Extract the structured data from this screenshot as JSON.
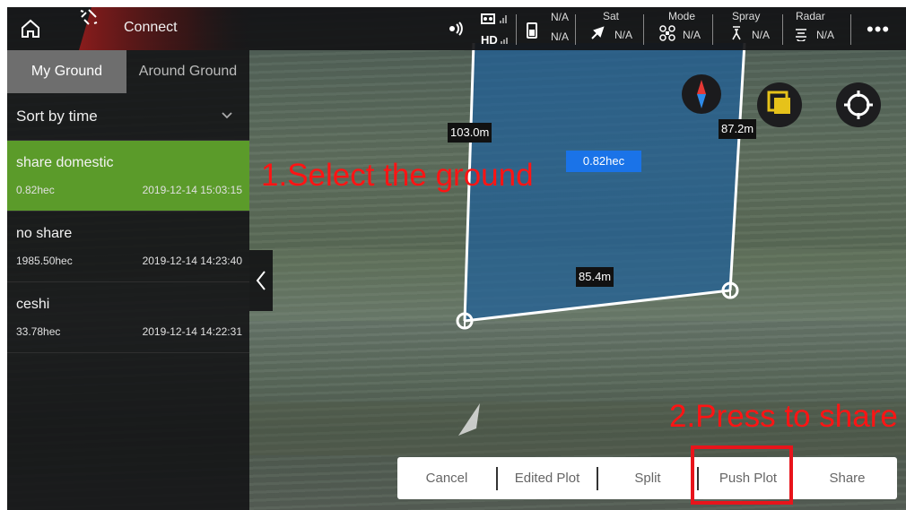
{
  "topbar": {
    "connect_label": "Connect",
    "signal_hd": "HD",
    "battery_value": "N/A",
    "battery_value2": "N/A",
    "stats": [
      {
        "label": "Sat",
        "value": "N/A",
        "icon": "satellite-icon"
      },
      {
        "label": "Mode",
        "value": "N/A",
        "icon": "drone-icon"
      },
      {
        "label": "Spray",
        "value": "N/A",
        "icon": "spray-icon"
      },
      {
        "label": "Radar",
        "value": "N/A",
        "icon": "radar-icon"
      }
    ],
    "more": "•••"
  },
  "sidebar": {
    "tabs": [
      "My Ground",
      "Around Ground"
    ],
    "sort_label": "Sort by time",
    "items": [
      {
        "name": "share domestic",
        "area": "0.82hec",
        "time": "2019-12-14 15:03:15",
        "selected": true
      },
      {
        "name": "no share",
        "area": "1985.50hec",
        "time": "2019-12-14 14:23:40",
        "selected": false
      },
      {
        "name": "ceshi",
        "area": "33.78hec",
        "time": "2019-12-14 14:22:31",
        "selected": false
      }
    ]
  },
  "map": {
    "edge_left": "103.0m",
    "edge_right": "87.2m",
    "edge_bottom": "85.4m",
    "area": "0.82hec",
    "polygon_fill": "#1f5f9a",
    "edge_color": "#ffffff"
  },
  "annotations": {
    "step1": "1.Select the ground",
    "step2": "2.Press to share",
    "color": "#ff1414"
  },
  "bottombar": {
    "cancel": "Cancel",
    "edited_plot": "Edited Plot",
    "split": "Split",
    "push_plot": "Push Plot",
    "share": "Share"
  },
  "colors": {
    "selected_item": "#5b9b2a",
    "area_tag": "#1a73e8",
    "highlight_box": "#e8141b"
  }
}
